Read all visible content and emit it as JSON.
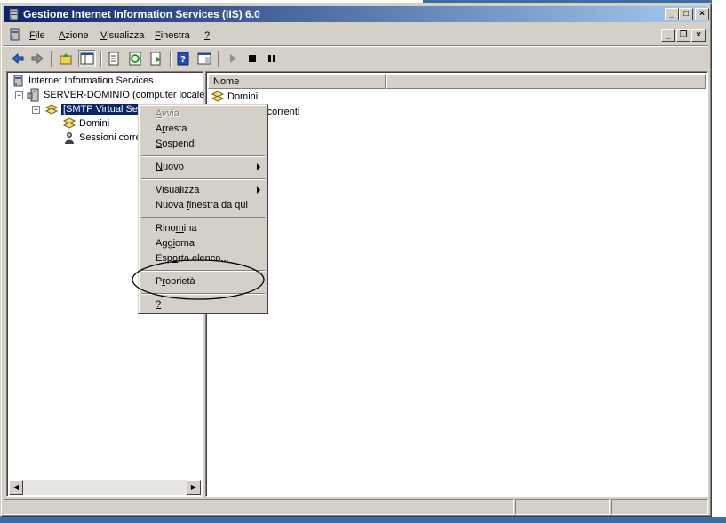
{
  "window": {
    "title": "Gestione Internet Information Services (IIS) 6.0",
    "minimize_glyph": "_",
    "maximize_glyph": "□",
    "close_glyph": "×",
    "mdi_minimize_glyph": "_",
    "mdi_restore_glyph": "❐",
    "mdi_close_glyph": "×"
  },
  "menu": {
    "items": [
      {
        "accel": "F",
        "rest": "ile"
      },
      {
        "accel": "A",
        "rest": "zione"
      },
      {
        "accel": "V",
        "rest": "isualizza"
      },
      {
        "accel": "F",
        "rest": "inestra"
      },
      {
        "accel": "?",
        "rest": ""
      }
    ]
  },
  "toolbar": {
    "icons": [
      "back-arrow-icon",
      "forward-arrow-icon",
      "up-folder-icon",
      "show-tree-icon",
      "properties-icon",
      "refresh-icon",
      "export-list-icon",
      "help-icon",
      "console-tree-icon",
      "play-icon",
      "stop-icon",
      "pause-icon"
    ]
  },
  "tree": {
    "root_label": "Internet Information Services",
    "server_label": "SERVER-DOMINIO (computer locale)",
    "smtp_label": "[SMTP Virtual Server #1]",
    "domains_label": "Domini",
    "sessions_label": "Sessioni correnti"
  },
  "list": {
    "column_header": "Nome",
    "rows": [
      "Domini",
      "Sessioni correnti"
    ]
  },
  "context_menu": {
    "avvia": {
      "accel": "A",
      "rest": "vvia",
      "disabled": true
    },
    "arresta_pre": "A",
    "arresta_accel": "r",
    "arresta_post": "resta",
    "sospendi": {
      "accel": "S",
      "rest": "ospendi"
    },
    "nuovo": {
      "accel": "N",
      "rest": "uovo"
    },
    "visualizza_pre": "Vi",
    "visualizza_accel": "s",
    "visualizza_post": "ualizza",
    "nuova_pre": "Nuova ",
    "nuova_accel": "f",
    "nuova_post": "inestra da qui",
    "rinomina_pre": "Rino",
    "rinomina_accel": "m",
    "rinomina_post": "ina",
    "aggiorna_pre": "Agg",
    "aggiorna_accel": "i",
    "aggiorna_post": "orna",
    "esporta_pre": "Esp",
    "esporta_accel": "o",
    "esporta_post": "rta elenco...",
    "proprieta_pre": "P",
    "proprieta_accel": "r",
    "proprieta_post": "oprietà",
    "help": {
      "accel": "?",
      "rest": ""
    }
  },
  "colors": {
    "title_gradient_start": "#0a246a",
    "title_gradient_end": "#a6caf0",
    "face": "#d4d0c8",
    "selection": "#0a246a",
    "desktop": "#3a6ea5"
  }
}
